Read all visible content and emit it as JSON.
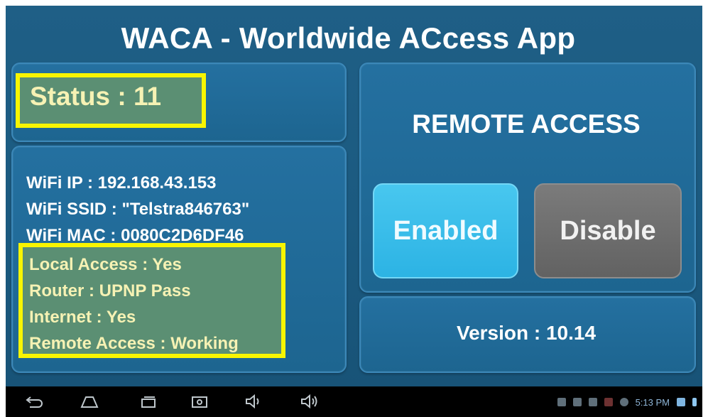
{
  "app": {
    "title": "WACA - Worldwide ACcess App"
  },
  "status": {
    "text": "Status : 11"
  },
  "network_info": {
    "lines": [
      "WiFi IP : 192.168.43.153",
      "WiFi SSID : \"Telstra846763\"",
      "WiFi MAC : 0080C2D6DF46"
    ]
  },
  "connection_status": {
    "lines": [
      "Local Access : Yes",
      "Router : UPNP Pass",
      "Internet : Yes",
      "Remote Access : Working"
    ]
  },
  "remote_access": {
    "title": "REMOTE ACCESS",
    "enabled_label": "Enabled",
    "disable_label": "Disable"
  },
  "version": {
    "text": "Version : 10.14"
  },
  "system_bar": {
    "icons": [
      "back-icon",
      "home-icon",
      "recent-apps-icon",
      "screenshot-icon",
      "volume-down-icon",
      "volume-up-icon"
    ],
    "clock": "5:13 PM"
  },
  "colors": {
    "background": "#1b5a80",
    "highlight_border": "#f8f500",
    "highlight_fill": "#5b8f73",
    "enabled_button": "#2cb3e4",
    "disable_button": "#6b6b6b"
  }
}
